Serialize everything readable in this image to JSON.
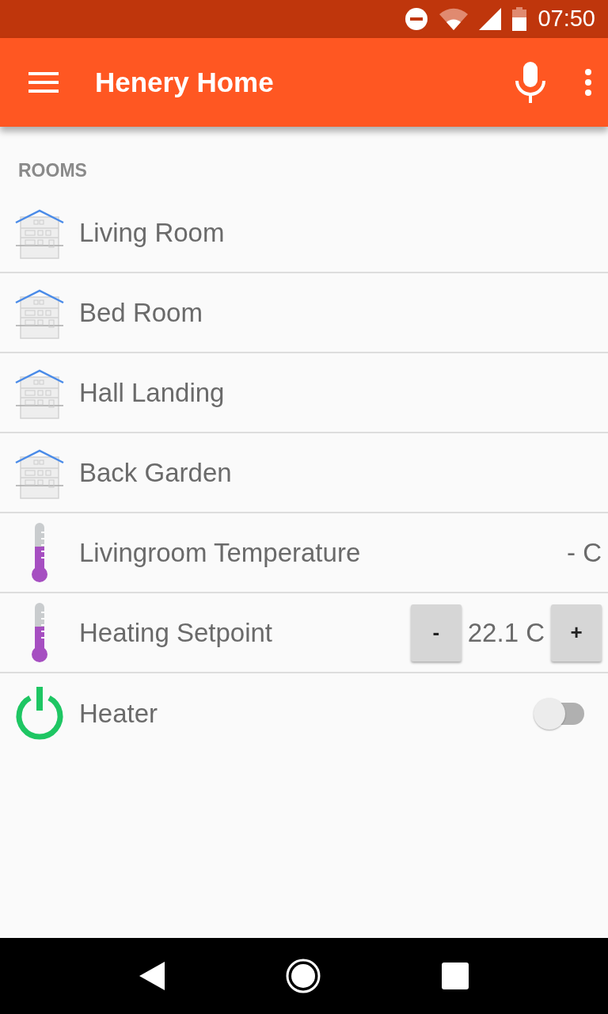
{
  "status_bar": {
    "time": "07:50"
  },
  "app_bar": {
    "title": "Henery Home"
  },
  "section": {
    "title": "ROOMS"
  },
  "items": [
    {
      "kind": "room",
      "label": "Living Room"
    },
    {
      "kind": "room",
      "label": "Bed Room"
    },
    {
      "kind": "room",
      "label": "Hall Landing"
    },
    {
      "kind": "room",
      "label": "Back Garden"
    },
    {
      "kind": "reading",
      "label": "Livingroom Temperature",
      "value": "- C"
    },
    {
      "kind": "setpoint",
      "label": "Heating Setpoint",
      "decrease": "-",
      "value": "22.1 C",
      "increase": "+"
    },
    {
      "kind": "switch",
      "label": "Heater",
      "on": false
    }
  ]
}
